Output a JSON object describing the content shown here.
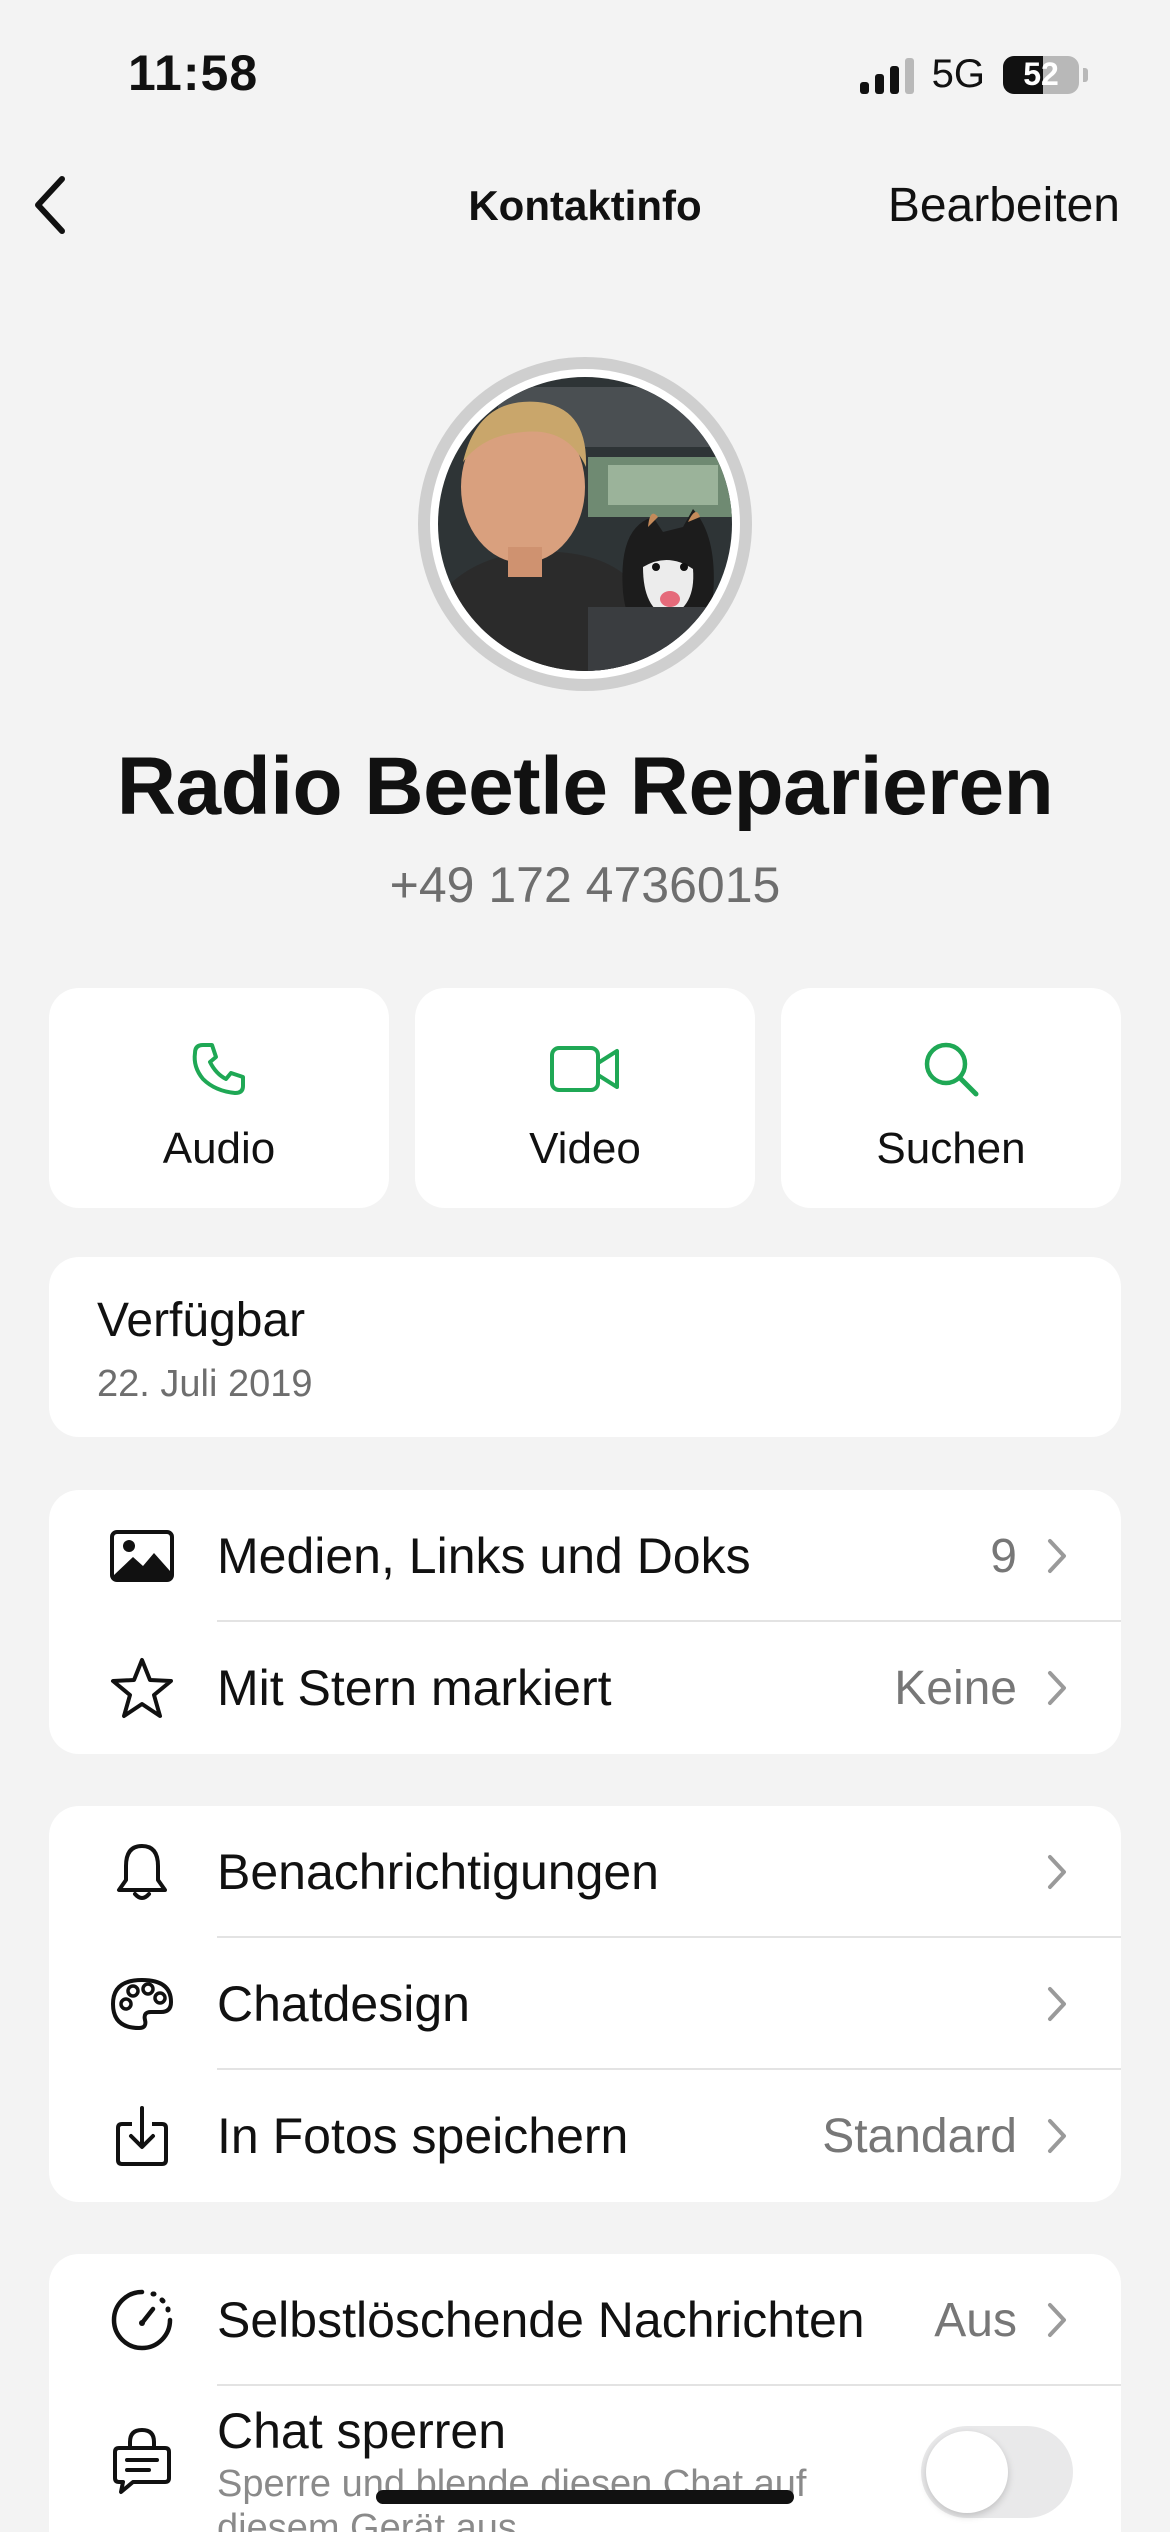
{
  "status_bar": {
    "time": "11:58",
    "network": "5G",
    "battery": "52",
    "battery_level_percent": 52
  },
  "nav": {
    "title": "Kontaktinfo",
    "edit_label": "Bearbeiten",
    "back_icon": "chevron-left-icon"
  },
  "contact": {
    "name": "Radio Beetle Reparieren",
    "phone": "+49 172 4736015"
  },
  "actions": [
    {
      "label": "Audio",
      "icon": "phone-icon"
    },
    {
      "label": "Video",
      "icon": "video-icon"
    },
    {
      "label": "Suchen",
      "icon": "search-icon"
    }
  ],
  "about": {
    "status": "Verfügbar",
    "date": "22. Juli 2019"
  },
  "media_section": [
    {
      "label": "Medien, Links und Doks",
      "value": "9",
      "icon": "image-icon"
    },
    {
      "label": "Mit Stern markiert",
      "value": "Keine",
      "icon": "star-icon"
    }
  ],
  "settings_section": [
    {
      "label": "Benachrichtigungen",
      "value": "",
      "icon": "bell-icon"
    },
    {
      "label": "Chatdesign",
      "value": "",
      "icon": "palette-icon"
    },
    {
      "label": "In Fotos speichern",
      "value": "Standard",
      "icon": "download-icon"
    }
  ],
  "privacy_section": {
    "disappearing": {
      "label": "Selbstlöschende Nachrichten",
      "value": "Aus",
      "icon": "timer-icon"
    },
    "lock": {
      "label": "Chat sperren",
      "subtitle": "Sperre und blende diesen Chat auf diesem Gerät aus.",
      "enabled": false,
      "icon": "lock-chat-icon"
    }
  },
  "colors": {
    "accent": "#1fa855",
    "background": "#f3f3f3",
    "card": "#ffffff",
    "secondary_text": "#6e6e6e"
  }
}
